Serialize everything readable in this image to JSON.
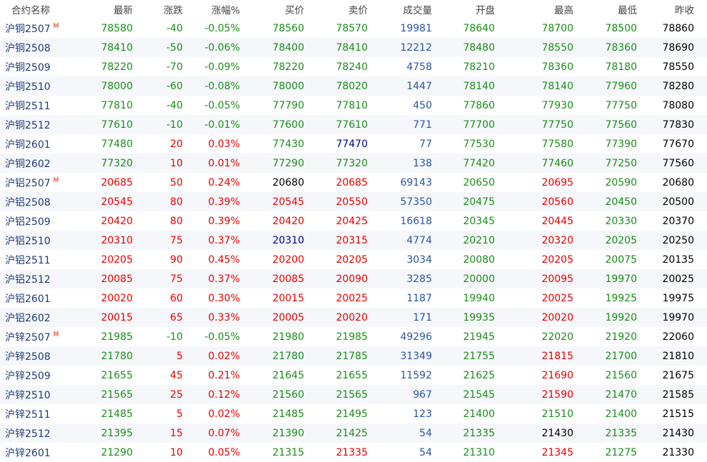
{
  "colors": {
    "up": "#e60000",
    "down": "#1a8c1a",
    "flat": "#000000",
    "volume": "#2b55a5",
    "name": "#1f3b78",
    "bid_highlight": "#000099"
  },
  "header": [
    "合约名称",
    "最新",
    "涨跌",
    "涨幅%",
    "买价",
    "卖价",
    "成交量",
    "开盘",
    "最高",
    "最低",
    "昨收"
  ],
  "rows": [
    {
      "name": "沪铜2507",
      "flag": "M",
      "cells": [
        "78580",
        "-40",
        "-0.05%",
        "78560",
        "78570",
        "19981",
        "78640",
        "78700",
        "78500",
        "78860"
      ]
    },
    {
      "name": "沪铜2508",
      "flag": "",
      "cells": [
        "78410",
        "-50",
        "-0.06%",
        "78400",
        "78410",
        "12212",
        "78480",
        "78550",
        "78360",
        "78690"
      ]
    },
    {
      "name": "沪铜2509",
      "flag": "",
      "cells": [
        "78220",
        "-70",
        "-0.09%",
        "78220",
        "78240",
        "4758",
        "78210",
        "78360",
        "78180",
        "78550"
      ]
    },
    {
      "name": "沪铜2510",
      "flag": "",
      "cells": [
        "78000",
        "-60",
        "-0.08%",
        "78000",
        "78020",
        "1447",
        "78140",
        "78140",
        "77960",
        "78280"
      ]
    },
    {
      "name": "沪铜2511",
      "flag": "",
      "cells": [
        "77810",
        "-40",
        "-0.05%",
        "77790",
        "77810",
        "450",
        "77860",
        "77930",
        "77750",
        "78080"
      ]
    },
    {
      "name": "沪铜2512",
      "flag": "",
      "cells": [
        "77610",
        "-10",
        "-0.01%",
        "77600",
        "77610",
        "771",
        "77700",
        "77750",
        "77560",
        "77830"
      ]
    },
    {
      "name": "沪铜2601",
      "flag": "",
      "cells": [
        "77480",
        "20",
        "0.03%",
        "77430",
        "77470",
        "77",
        "77530",
        "77580",
        "77390",
        "77670"
      ]
    },
    {
      "name": "沪铜2602",
      "flag": "",
      "cells": [
        "77320",
        "10",
        "0.01%",
        "77290",
        "77320",
        "138",
        "77420",
        "77460",
        "77250",
        "77560"
      ]
    },
    {
      "name": "沪铝2507",
      "flag": "M",
      "cells": [
        "20685",
        "50",
        "0.24%",
        "20680",
        "20685",
        "69143",
        "20650",
        "20695",
        "20590",
        "20680"
      ]
    },
    {
      "name": "沪铝2508",
      "flag": "",
      "cells": [
        "20545",
        "80",
        "0.39%",
        "20545",
        "20550",
        "57350",
        "20475",
        "20560",
        "20450",
        "20500"
      ]
    },
    {
      "name": "沪铝2509",
      "flag": "",
      "cells": [
        "20420",
        "80",
        "0.39%",
        "20420",
        "20425",
        "16618",
        "20345",
        "20445",
        "20330",
        "20370"
      ]
    },
    {
      "name": "沪铝2510",
      "flag": "",
      "cells": [
        "20310",
        "75",
        "0.37%",
        "20310",
        "20315",
        "4774",
        "20210",
        "20320",
        "20205",
        "20250"
      ]
    },
    {
      "name": "沪铝2511",
      "flag": "",
      "cells": [
        "20205",
        "90",
        "0.45%",
        "20200",
        "20205",
        "3034",
        "20080",
        "20205",
        "20075",
        "20135"
      ]
    },
    {
      "name": "沪铝2512",
      "flag": "",
      "cells": [
        "20085",
        "75",
        "0.37%",
        "20085",
        "20090",
        "3285",
        "20000",
        "20095",
        "19970",
        "20025"
      ]
    },
    {
      "name": "沪铝2601",
      "flag": "",
      "cells": [
        "20020",
        "60",
        "0.30%",
        "20015",
        "20025",
        "1187",
        "19940",
        "20025",
        "19925",
        "19975"
      ]
    },
    {
      "name": "沪铝2602",
      "flag": "",
      "cells": [
        "20015",
        "65",
        "0.33%",
        "20005",
        "20020",
        "171",
        "19935",
        "20020",
        "19920",
        "19970"
      ]
    },
    {
      "name": "沪锌2507",
      "flag": "M",
      "cells": [
        "21985",
        "-10",
        "-0.05%",
        "21980",
        "21985",
        "49296",
        "21945",
        "22020",
        "21920",
        "22060"
      ]
    },
    {
      "name": "沪锌2508",
      "flag": "",
      "cells": [
        "21780",
        "5",
        "0.02%",
        "21780",
        "21785",
        "31349",
        "21755",
        "21815",
        "21700",
        "21810"
      ]
    },
    {
      "name": "沪锌2509",
      "flag": "",
      "cells": [
        "21655",
        "45",
        "0.21%",
        "21645",
        "21655",
        "11592",
        "21625",
        "21690",
        "21560",
        "21675"
      ]
    },
    {
      "name": "沪锌2510",
      "flag": "",
      "cells": [
        "21565",
        "25",
        "0.12%",
        "21560",
        "21565",
        "967",
        "21545",
        "21590",
        "21470",
        "21585"
      ]
    },
    {
      "name": "沪锌2511",
      "flag": "",
      "cells": [
        "21485",
        "5",
        "0.02%",
        "21485",
        "21495",
        "123",
        "21400",
        "21510",
        "21400",
        "21515"
      ]
    },
    {
      "name": "沪锌2512",
      "flag": "",
      "cells": [
        "21395",
        "15",
        "0.07%",
        "21390",
        "21425",
        "54",
        "21335",
        "21430",
        "21335",
        "21430"
      ]
    },
    {
      "name": "沪锌2601",
      "flag": "",
      "cells": [
        "21290",
        "10",
        "0.05%",
        "21315",
        "21335",
        "54",
        "21310",
        "21345",
        "21275",
        "21330"
      ]
    }
  ],
  "highlights": {
    "沪铜2601": {
      "4": "bid_highlight"
    },
    "沪铝2510": {
      "3": "bid_highlight"
    }
  }
}
